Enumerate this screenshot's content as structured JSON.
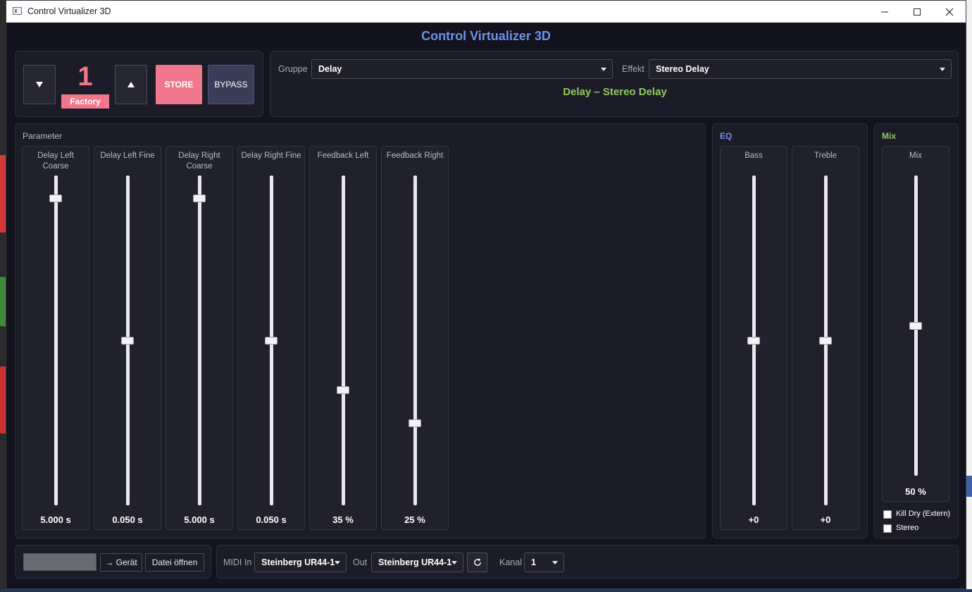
{
  "window": {
    "title": "Control Virtualizer 3D"
  },
  "app": {
    "title": "Control Virtualizer 3D"
  },
  "preset": {
    "number": "1",
    "name": "Factory",
    "store_label": "STORE",
    "bypass_label": "BYPASS"
  },
  "selector": {
    "group_label": "Gruppe",
    "group_value": "Delay",
    "effect_label": "Effekt",
    "effect_value": "Stereo Delay",
    "summary": "Delay – Stereo Delay"
  },
  "parameters": {
    "section_label": "Parameter",
    "items": [
      {
        "name": "Delay Left Coarse",
        "value": "5.000 s",
        "level": 0.93
      },
      {
        "name": "Delay Left Fine",
        "value": "0.050 s",
        "level": 0.5
      },
      {
        "name": "Delay Right Coarse",
        "value": "5.000 s",
        "level": 0.93
      },
      {
        "name": "Delay Right Fine",
        "value": "0.050 s",
        "level": 0.5
      },
      {
        "name": "Feedback Left",
        "value": "35 %",
        "level": 0.35
      },
      {
        "name": "Feedback Right",
        "value": "25 %",
        "level": 0.25
      }
    ]
  },
  "eq": {
    "section_label": "EQ",
    "items": [
      {
        "name": "Bass",
        "value": "+0",
        "level": 0.5
      },
      {
        "name": "Treble",
        "value": "+0",
        "level": 0.5
      }
    ]
  },
  "mix": {
    "section_label": "Mix",
    "item": {
      "name": "Mix",
      "value": "50 %",
      "level": 0.5
    },
    "kill_dry_label": "Kill Dry (Extern)",
    "stereo_label": "Stereo"
  },
  "bottom": {
    "file_placeholder": "",
    "to_device_label": "→ Gerät",
    "open_file_label": "Datei öffnen",
    "midi_in_label": "MIDI In",
    "midi_in_value": "Steinberg UR44-1",
    "out_label": "Out",
    "out_value": "Steinberg UR44-1",
    "channel_label": "Kanal",
    "channel_value": "1"
  },
  "colors": {
    "accent_blue": "#6e8fec",
    "accent_green": "#8fc95b",
    "preset_pink": "#f0778c",
    "background": "#13131d"
  },
  "icons": [
    "minimize-icon",
    "maximize-icon",
    "close-icon",
    "arrow-down-icon",
    "arrow-up-icon",
    "refresh-icon",
    "chevron-down-icon"
  ]
}
